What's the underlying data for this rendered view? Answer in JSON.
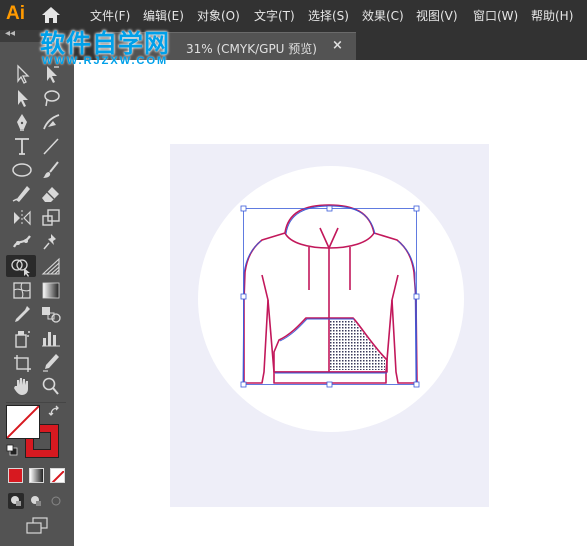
{
  "app": {
    "logo_text": "Ai"
  },
  "menu": [
    {
      "label": "文件(F)"
    },
    {
      "label": "编辑(E)"
    },
    {
      "label": "对象(O)"
    },
    {
      "label": "文字(T)"
    },
    {
      "label": "选择(S)"
    },
    {
      "label": "效果(C)"
    },
    {
      "label": "视图(V)"
    },
    {
      "label": "窗口(W)"
    },
    {
      "label": "帮助(H)"
    }
  ],
  "document_tab": {
    "label": "31% (CMYK/GPU 预览)",
    "close_label": "×"
  },
  "watermark": {
    "main": "软件自学网",
    "sub": "WWW.RJZXW.COM"
  },
  "toolbar": {
    "collapse_label": "◂◂",
    "tools": [
      {
        "name": "selection-tool"
      },
      {
        "name": "direct-selection-tool"
      },
      {
        "name": "selection-arrow-tool"
      },
      {
        "name": "lasso-tool"
      },
      {
        "name": "pen-tool"
      },
      {
        "name": "curvature-tool"
      },
      {
        "name": "type-tool"
      },
      {
        "name": "line-segment-tool"
      },
      {
        "name": "ellipse-tool"
      },
      {
        "name": "paintbrush-tool"
      },
      {
        "name": "shaper-tool"
      },
      {
        "name": "eraser-tool"
      },
      {
        "name": "reflect-tool"
      },
      {
        "name": "scale-tool"
      },
      {
        "name": "puppet-warp-tool"
      },
      {
        "name": "pin-tool"
      },
      {
        "name": "shape-builder-tool",
        "active": true
      },
      {
        "name": "perspective-grid-tool"
      },
      {
        "name": "mesh-tool"
      },
      {
        "name": "gradient-tool"
      },
      {
        "name": "eyedropper-tool"
      },
      {
        "name": "blend-tool"
      },
      {
        "name": "symbol-sprayer-tool"
      },
      {
        "name": "column-graph-tool"
      },
      {
        "name": "artboard-tool"
      },
      {
        "name": "slice-tool"
      },
      {
        "name": "hand-tool"
      },
      {
        "name": "zoom-tool"
      }
    ]
  },
  "colors": {
    "fill": "#ffffff",
    "stroke": "#D71920",
    "artboard_bg": "#EEEEF8",
    "selection": "#3A5BD9",
    "outline": "#C2185B"
  }
}
